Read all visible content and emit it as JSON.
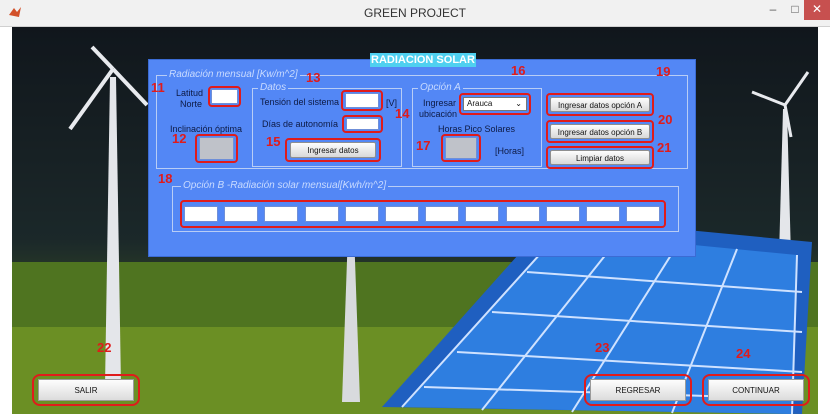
{
  "window": {
    "title": "GREEN PROJECT",
    "minimize": "‒",
    "maximize": "□",
    "close": "✕"
  },
  "panel": {
    "title": "RADIACION SOLAR"
  },
  "radiacion_mensual": {
    "label": "Radiación mensual [Kw/m^2]",
    "latitud_label": [
      "Latitud",
      "Norte"
    ],
    "inclinacion_label": "Inclinación óptima"
  },
  "datos": {
    "label": "Datos",
    "tension_label": "Tensión del sistema",
    "tension_unit": "[V]",
    "dias_label": "Días de autonomía",
    "ingresar_button": "Ingresar datos"
  },
  "opcion_a": {
    "label": "Opción A",
    "ubicacion_label": [
      "Ingresar",
      "ubicación"
    ],
    "ubicacion_value": "Arauca",
    "horas_label": "Horas Pico Solares",
    "horas_unit": "[Horas]"
  },
  "side_buttons": {
    "opcion_a": "Ingresar datos opción A",
    "opcion_b": "Ingresar datos opción B",
    "limpiar": "Limpiar datos"
  },
  "opcion_b": {
    "label": "Opción B -Radiación solar mensual[Kwh/m^2]",
    "fields": [
      "",
      "",
      "",
      "",
      "",
      "",
      "",
      "",
      "",
      "",
      "",
      ""
    ]
  },
  "footer": {
    "salir": "SALIR",
    "regresar": "REGRESAR",
    "continuar": "CONTINUAR"
  },
  "annotations": [
    "11",
    "12",
    "13",
    "14",
    "15",
    "16",
    "17",
    "18",
    "19",
    "20",
    "21",
    "22",
    "23",
    "24"
  ],
  "colors": {
    "panel": "#5387f5",
    "title_bar": "#4fd0f0",
    "highlight": "#e01b1b"
  }
}
